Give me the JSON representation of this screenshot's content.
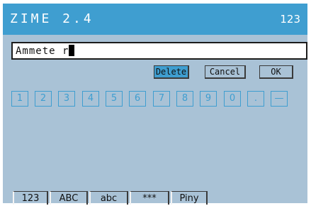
{
  "header": {
    "title": "ZIME 2.4",
    "mode_indicator": "123"
  },
  "input": {
    "value": "Ammete r"
  },
  "actions": {
    "delete_label": "Delete",
    "cancel_label": "Cancel",
    "ok_label": "OK"
  },
  "keys": [
    "1",
    "2",
    "3",
    "4",
    "5",
    "6",
    "7",
    "8",
    "9",
    "0",
    ".",
    "—"
  ],
  "tabs": [
    "123",
    "ABC",
    "abc",
    "***",
    "Piny"
  ],
  "colors": {
    "accent": "#3f9ed0",
    "screen_bg": "#a9c2d6",
    "title_text": "#ffffff"
  }
}
